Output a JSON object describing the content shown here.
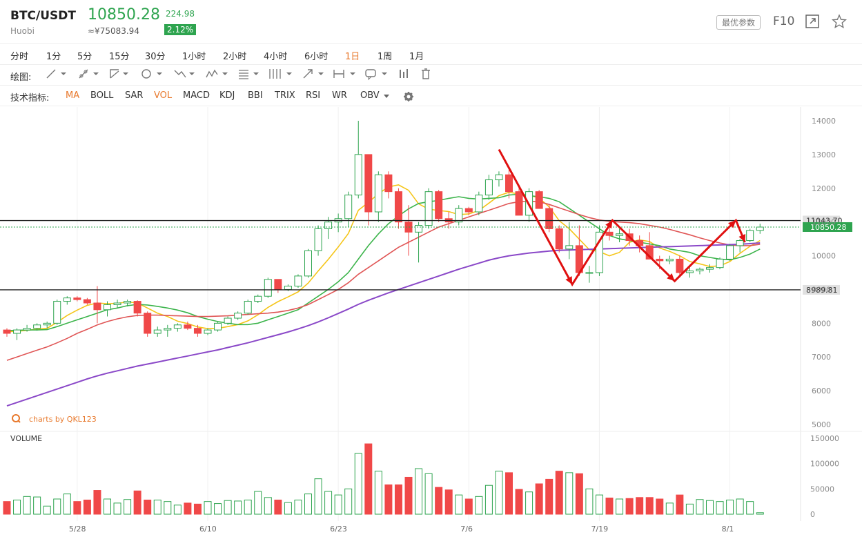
{
  "header": {
    "symbol": "BTC/USDT",
    "exchange": "Huobi",
    "price": "10850.28",
    "price_cny": "≈¥75083.94",
    "change": "224.98",
    "change_pct": "2.12%",
    "params_label": "最优参数",
    "f10_label": "F10"
  },
  "periods": [
    "分时",
    "1分",
    "5分",
    "15分",
    "30分",
    "1小时",
    "2小时",
    "4小时",
    "6小时",
    "1日",
    "1周",
    "1月"
  ],
  "active_period": "1日",
  "drawing_label": "绘图:",
  "indicators_label": "技术指标:",
  "indicators": [
    "MA",
    "BOLL",
    "SAR",
    "VOL",
    "MACD",
    "KDJ",
    "BBI",
    "TRIX",
    "RSI",
    "WR",
    "OBV"
  ],
  "active_indicators": [
    "MA",
    "VOL"
  ],
  "watermark": "charts by QKL123",
  "volume_label": "VOLUME",
  "colors": {
    "up": "#2ea44f",
    "down": "#f04848",
    "ma5": "#f5c518",
    "ma10": "#3cb44b",
    "ma30": "#e05555",
    "ma60": "#8a48c8",
    "annotation": "#e01010"
  },
  "chart_data": {
    "type": "candlestick",
    "price_axis": {
      "ticks": [
        5000,
        6000,
        7000,
        8000,
        9000,
        10000,
        11000,
        12000,
        13000,
        14000
      ],
      "range": [
        4800,
        14300
      ]
    },
    "volume_axis": {
      "ticks": [
        0,
        50000,
        100000,
        150000
      ],
      "range": [
        0,
        150000
      ]
    },
    "x_labels": [
      {
        "label": "5/28",
        "index": 7
      },
      {
        "label": "6/10",
        "index": 20
      },
      {
        "label": "6/23",
        "index": 33
      },
      {
        "label": "7/6",
        "index": 46
      },
      {
        "label": "7/19",
        "index": 59
      },
      {
        "label": "8/1",
        "index": 72
      }
    ],
    "price_lines": [
      {
        "label": "11043.70",
        "value": 11043.7
      },
      {
        "label": "8989.81",
        "value": 8989.81
      }
    ],
    "current_price": {
      "label": "10850.28",
      "value": 10850.28
    },
    "candles": [
      [
        7800,
        7850,
        7600,
        7700
      ],
      [
        7700,
        7850,
        7500,
        7800
      ],
      [
        7800,
        7950,
        7750,
        7850
      ],
      [
        7850,
        8000,
        7780,
        7950
      ],
      [
        7950,
        8050,
        7850,
        8000
      ],
      [
        8000,
        8700,
        7950,
        8650
      ],
      [
        8650,
        8800,
        8550,
        8750
      ],
      [
        8750,
        8800,
        8650,
        8700
      ],
      [
        8700,
        8750,
        8550,
        8600
      ],
      [
        8600,
        9100,
        8000,
        8400
      ],
      [
        8400,
        8650,
        8200,
        8550
      ],
      [
        8550,
        8700,
        8450,
        8600
      ],
      [
        8600,
        8700,
        8500,
        8650
      ],
      [
        8650,
        8680,
        8200,
        8300
      ],
      [
        8300,
        8350,
        7600,
        7700
      ],
      [
        7700,
        7900,
        7600,
        7800
      ],
      [
        7800,
        7950,
        7600,
        7850
      ],
      [
        7850,
        8000,
        7750,
        7950
      ],
      [
        7950,
        8050,
        7800,
        7850
      ],
      [
        7850,
        7950,
        7600,
        7700
      ],
      [
        7700,
        7850,
        7650,
        7800
      ],
      [
        7800,
        8050,
        7750,
        8000
      ],
      [
        8000,
        8200,
        7950,
        8150
      ],
      [
        8150,
        8350,
        8100,
        8300
      ],
      [
        8300,
        8700,
        8250,
        8650
      ],
      [
        8650,
        8850,
        8600,
        8800
      ],
      [
        8800,
        9350,
        8750,
        9300
      ],
      [
        9300,
        9200,
        8900,
        9000
      ],
      [
        9000,
        9150,
        8950,
        9100
      ],
      [
        9100,
        9450,
        9050,
        9400
      ],
      [
        9400,
        10200,
        9350,
        10150
      ],
      [
        10150,
        10900,
        10000,
        10800
      ],
      [
        10800,
        11150,
        10500,
        11000
      ],
      [
        11000,
        11250,
        10700,
        11100
      ],
      [
        11100,
        11900,
        10850,
        11800
      ],
      [
        11800,
        14000,
        11700,
        13000
      ],
      [
        13000,
        13000,
        10900,
        11300
      ],
      [
        11300,
        12500,
        11000,
        12400
      ],
      [
        12400,
        12500,
        11700,
        11900
      ],
      [
        11900,
        12000,
        10800,
        11000
      ],
      [
        11000,
        11500,
        10000,
        10700
      ],
      [
        10700,
        11000,
        9800,
        10900
      ],
      [
        10900,
        12000,
        10800,
        11900
      ],
      [
        11900,
        11950,
        11000,
        11100
      ],
      [
        11100,
        11300,
        10800,
        11000
      ],
      [
        11000,
        11500,
        10900,
        11400
      ],
      [
        11400,
        11450,
        11200,
        11300
      ],
      [
        11300,
        11900,
        11200,
        11800
      ],
      [
        11800,
        12400,
        11650,
        12250
      ],
      [
        12250,
        12500,
        12050,
        12400
      ],
      [
        12400,
        12600,
        11700,
        11900
      ],
      [
        11900,
        12100,
        11200,
        11200
      ],
      [
        11200,
        12000,
        11000,
        11900
      ],
      [
        11900,
        11950,
        11400,
        11400
      ],
      [
        11400,
        11500,
        10700,
        10800
      ],
      [
        10800,
        10900,
        10100,
        10200
      ],
      [
        10200,
        11000,
        9900,
        10300
      ],
      [
        10300,
        10900,
        9400,
        9500
      ],
      [
        9500,
        9700,
        9200,
        9500
      ],
      [
        9500,
        10900,
        9400,
        10700
      ],
      [
        10700,
        11000,
        10450,
        10600
      ],
      [
        10600,
        10800,
        10400,
        10650
      ],
      [
        10650,
        10800,
        10300,
        10450
      ],
      [
        10450,
        10600,
        10100,
        10300
      ],
      [
        10300,
        10700,
        10000,
        9900
      ],
      [
        9900,
        10000,
        9600,
        9850
      ],
      [
        9850,
        10000,
        9750,
        9900
      ],
      [
        9900,
        10000,
        9400,
        9500
      ],
      [
        9500,
        9650,
        9350,
        9550
      ],
      [
        9550,
        9650,
        9450,
        9600
      ],
      [
        9600,
        9750,
        9500,
        9650
      ],
      [
        9650,
        9950,
        9600,
        9900
      ],
      [
        9900,
        10350,
        9850,
        10300
      ],
      [
        10300,
        10500,
        10100,
        10450
      ],
      [
        10450,
        10800,
        10400,
        10750
      ],
      [
        10750,
        10950,
        10650,
        10850
      ]
    ],
    "volumes": [
      25000,
      28000,
      35000,
      34000,
      16000,
      30000,
      40000,
      25000,
      28000,
      47000,
      30000,
      22000,
      29000,
      46000,
      28000,
      28000,
      25000,
      18000,
      22000,
      20000,
      25000,
      21000,
      27000,
      26000,
      28000,
      45000,
      33000,
      28000,
      23000,
      28000,
      40000,
      70000,
      45000,
      38000,
      50000,
      120000,
      139000,
      85000,
      58000,
      58000,
      73000,
      90000,
      80000,
      53000,
      48000,
      38000,
      30000,
      35000,
      57000,
      85000,
      82000,
      49000,
      44000,
      60000,
      69000,
      85000,
      82000,
      80000,
      50000,
      38000,
      32000,
      30000,
      31000,
      33000,
      33000,
      30000,
      22000,
      38000,
      20000,
      29000,
      27000,
      25000,
      28000,
      30000,
      25000,
      3000
    ],
    "ma_series": [
      {
        "name": "MA5",
        "values": [
          7750,
          7760,
          7790,
          7820,
          7850,
          8030,
          8230,
          8390,
          8530,
          8600,
          8580,
          8590,
          8630,
          8600,
          8450,
          8300,
          8200,
          8060,
          7990,
          7890,
          7840,
          7850,
          7900,
          7960,
          8070,
          8250,
          8470,
          8640,
          8780,
          8930,
          9190,
          9550,
          9890,
          10260,
          10660,
          11350,
          11580,
          11840,
          12040,
          12100,
          11940,
          11540,
          11380,
          11340,
          11310,
          11220,
          11240,
          11340,
          11560,
          11780,
          11880,
          11830,
          11800,
          11710,
          11450,
          11040,
          10800,
          10490,
          10180,
          10120,
          10000,
          10100,
          10400,
          10470,
          10420,
          10230,
          10130,
          10000,
          9830,
          9760,
          9680,
          9700,
          9830,
          10070,
          10280,
          10450
        ]
      },
      {
        "name": "MA10",
        "values": [
          7780,
          7790,
          7800,
          7800,
          7810,
          7900,
          8000,
          8100,
          8200,
          8300,
          8400,
          8450,
          8520,
          8560,
          8540,
          8500,
          8450,
          8390,
          8310,
          8200,
          8120,
          8050,
          8000,
          7960,
          7960,
          8000,
          8100,
          8200,
          8300,
          8400,
          8600,
          8800,
          9000,
          9230,
          9500,
          9900,
          10300,
          10650,
          10950,
          11180,
          11390,
          11550,
          11600,
          11640,
          11700,
          11750,
          11700,
          11680,
          11700,
          11720,
          11800,
          11820,
          11780,
          11750,
          11700,
          11600,
          11400,
          11200,
          11000,
          10800,
          10600,
          10500,
          10450,
          10400,
          10350,
          10300,
          10200,
          10150,
          10100,
          10000,
          9950,
          9900,
          9880,
          9950,
          10050,
          10200
        ]
      },
      {
        "name": "MA30",
        "values": [
          6900,
          7000,
          7100,
          7200,
          7300,
          7420,
          7550,
          7700,
          7820,
          7950,
          8050,
          8130,
          8190,
          8230,
          8240,
          8240,
          8230,
          8220,
          8210,
          8200,
          8200,
          8210,
          8220,
          8240,
          8260,
          8280,
          8300,
          8330,
          8380,
          8450,
          8550,
          8700,
          8850,
          9000,
          9200,
          9450,
          9650,
          9850,
          10050,
          10250,
          10400,
          10550,
          10700,
          10850,
          10950,
          11050,
          11150,
          11250,
          11350,
          11450,
          11550,
          11600,
          11620,
          11600,
          11520,
          11420,
          11320,
          11220,
          11130,
          11060,
          11020,
          11000,
          10980,
          10950,
          10900,
          10850,
          10780,
          10700,
          10620,
          10530,
          10450,
          10380,
          10320,
          10300,
          10300,
          10340
        ]
      },
      {
        "name": "MA60",
        "values": [
          5550,
          5650,
          5750,
          5850,
          5950,
          6050,
          6150,
          6250,
          6350,
          6440,
          6520,
          6590,
          6660,
          6730,
          6790,
          6850,
          6910,
          6970,
          7030,
          7090,
          7150,
          7210,
          7280,
          7350,
          7420,
          7500,
          7580,
          7660,
          7740,
          7830,
          7930,
          8040,
          8160,
          8290,
          8420,
          8560,
          8680,
          8790,
          8900,
          9000,
          9100,
          9200,
          9300,
          9400,
          9500,
          9600,
          9690,
          9780,
          9870,
          9940,
          10000,
          10040,
          10080,
          10110,
          10140,
          10160,
          10170,
          10180,
          10190,
          10200,
          10210,
          10220,
          10230,
          10240,
          10250,
          10260,
          10270,
          10280,
          10290,
          10300,
          10310,
          10320,
          10330,
          10340,
          10360,
          10380
        ]
      }
    ],
    "annotation_zigzag": [
      [
        49,
        13150
      ],
      [
        56.3,
        9150
      ],
      [
        60.3,
        11050
      ],
      [
        66.5,
        9250
      ],
      [
        72.6,
        11050
      ],
      [
        73.5,
        10400
      ]
    ]
  }
}
